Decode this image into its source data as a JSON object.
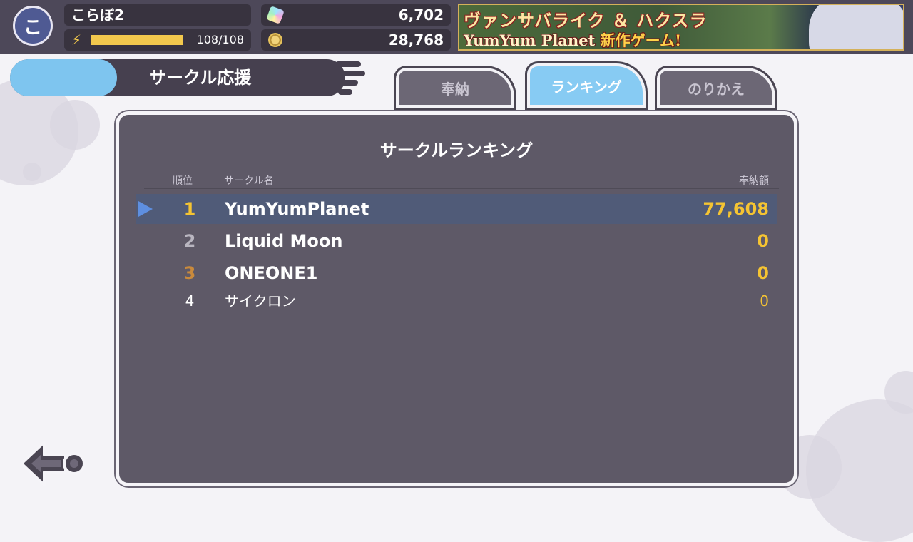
{
  "player": {
    "avatar_char": "こ",
    "name": "こらぼ2",
    "stamina_text": "108/108",
    "stamina_fraction": 1.0
  },
  "currencies": [
    {
      "icon": "gem-icon",
      "value": "6,702"
    },
    {
      "icon": "coin-icon",
      "value": "28,768"
    }
  ],
  "banner": {
    "line1": "ヴァンサバライク ＆ ハクスラ",
    "line2_name": "YumYum Planet",
    "line2_suffix": "新作ゲーム!"
  },
  "page": {
    "title": "サークル応援"
  },
  "tabs": [
    {
      "label": "奉納",
      "active": false
    },
    {
      "label": "ランキング",
      "active": true
    },
    {
      "label": "のりかえ",
      "active": false
    }
  ],
  "ranking": {
    "title": "サークルランキング",
    "columns": {
      "rank": "順位",
      "name": "サークル名",
      "amount": "奉納額"
    },
    "rows": [
      {
        "rank": "1",
        "name": "YumYumPlanet",
        "amount": "77,608",
        "rank_color": "#f5c432"
      },
      {
        "rank": "2",
        "name": "Liquid Moon",
        "amount": "0",
        "rank_color": "#b9b6c0"
      },
      {
        "rank": "3",
        "name": "ONEONE1",
        "amount": "0",
        "rank_color": "#c98a3c"
      },
      {
        "rank": "4",
        "name": "サイクロン",
        "amount": "0",
        "rank_color": "#ffffff"
      }
    ]
  },
  "colors": {
    "accent_blue": "#87cbf3",
    "gold": "#f5c432",
    "panel": "#5e5967"
  }
}
